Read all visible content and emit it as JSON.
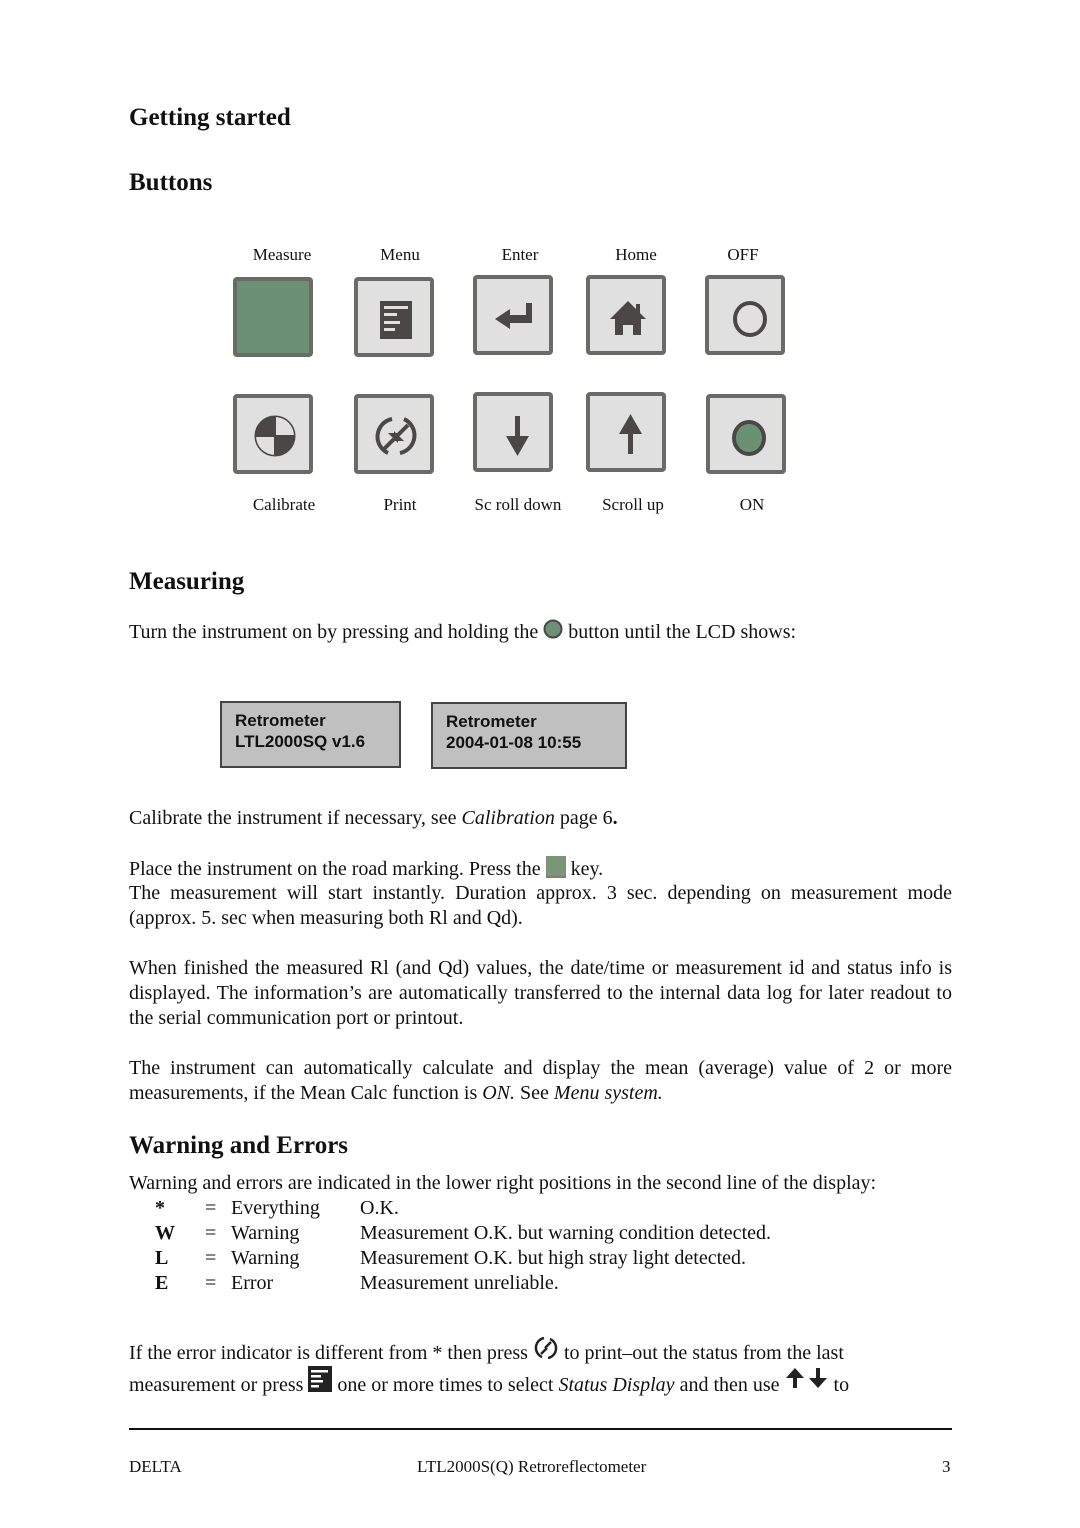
{
  "headings": {
    "getting_started": "Getting started",
    "buttons": "Buttons",
    "measuring": "Measuring",
    "warnings": "Warning and Errors"
  },
  "buttons_top": [
    {
      "label": "Measure",
      "icon": "measure-key-green-square"
    },
    {
      "label": "Menu",
      "icon": "menu-list-icon"
    },
    {
      "label": "Enter",
      "icon": "enter-return-arrow-icon"
    },
    {
      "label": "Home",
      "icon": "home-house-icon"
    },
    {
      "label": "OFF",
      "icon": "power-off-circle-icon"
    }
  ],
  "buttons_bottom": [
    {
      "label": "Calibrate",
      "icon": "calibrate-target-icon"
    },
    {
      "label": "Print",
      "icon": "print-cycle-arrows-icon"
    },
    {
      "label": "Sc roll down",
      "icon": "arrow-down-icon"
    },
    {
      "label": "Scroll up",
      "icon": "arrow-up-icon"
    },
    {
      "label": "ON",
      "icon": "power-on-green-circle-icon"
    }
  ],
  "measuring": {
    "intro_before": "Turn the instrument on by pressing and holding the",
    "intro_after": "button until the LCD shows:",
    "lcd1": {
      "line1": "Retrometer",
      "line2": "LTL2000SQ v1.6"
    },
    "lcd2": {
      "line1": "Retrometer",
      "line2": "2004-01-08 10:55"
    },
    "calibrate_before": "Calibrate the instrument if necessary, see ",
    "calibrate_italic": "Calibration",
    "calibrate_after": " page 6",
    "calibrate_period": ".",
    "place_before": "Place the instrument on the road marking. Press the",
    "place_after": "key.",
    "duration": "The measurement will start instantly. Duration approx. 3 sec. depending on measurement mode (approx. 5. sec when measuring both Rl and Qd).",
    "finished": "When finished the measured Rl (and Qd) values, the date/time or measurement id and status info is displayed. The information’s are automatically transferred to the internal data log for later readout to the serial communication port or printout.",
    "mean_before": "The instrument can automatically calculate and display the mean (average) value of 2 or more measurements, if the Mean Calc function is ",
    "mean_on": "ON.",
    "mean_see": " See ",
    "mean_link": "Menu system."
  },
  "warnings": {
    "intro": "Warning and errors are indicated in the lower right positions in the second line of the display:",
    "rows": [
      {
        "code": "*",
        "eq": "=",
        "type": "Everything",
        "desc": "O.K."
      },
      {
        "code": "W",
        "eq": "=",
        "type": "Warning",
        "desc": "Measurement O.K. but warning condition detected."
      },
      {
        "code": "L",
        "eq": "=",
        "type": "Warning",
        "desc": "Measurement O.K. but high stray light detected."
      },
      {
        "code": "E",
        "eq": "=",
        "type": "Error",
        "desc": "Measurement unreliable."
      }
    ],
    "para_1a": "If the error indicator is different from * then press",
    "para_1b": "to print–out the status from the last",
    "para_2a": "measurement or press",
    "para_2b": " one or more times to select ",
    "para_2c": "Status Display",
    "para_2d": " and then use",
    "para_2e": " to"
  },
  "footer": {
    "left": "DELTA",
    "center": "LTL2000S(Q) Retroreflectometer",
    "page": "3"
  },
  "colors": {
    "key_green": "#6b9175",
    "key_gray": "#e0e0e0",
    "key_border": "#6b6b66",
    "icon_dark": "#4a4746",
    "lcd_bg": "#c0c0c0"
  }
}
